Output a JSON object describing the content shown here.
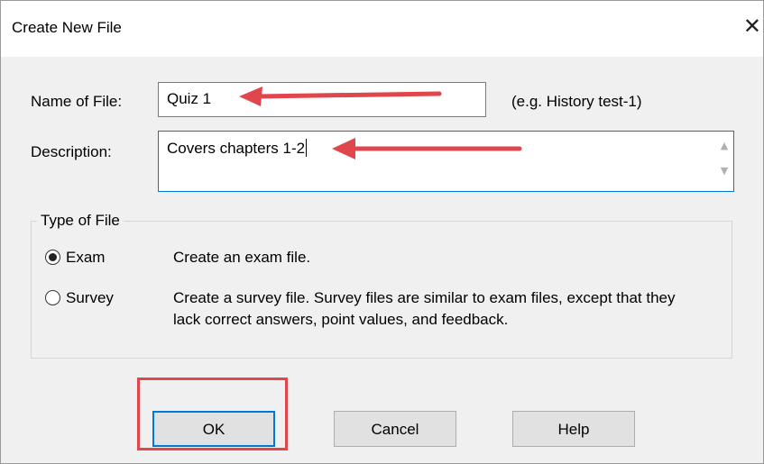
{
  "window": {
    "title": "Create New File",
    "close_glyph": "✕"
  },
  "form": {
    "name_label": "Name of File:",
    "name_value": "Quiz 1",
    "name_hint": "(e.g. History test-1)",
    "description_label": "Description:",
    "description_value": "Covers chapters 1-2"
  },
  "type_group": {
    "title": "Type of File",
    "options": [
      {
        "label": "Exam",
        "selected": true,
        "description": "Create an exam file."
      },
      {
        "label": "Survey",
        "selected": false,
        "description_line1": "Create a survey file.  Survey files are similar to exam files, except that they",
        "description_line2": "lack correct answers, point values, and feedback."
      }
    ]
  },
  "buttons": {
    "ok": "OK",
    "cancel": "Cancel",
    "help": "Help"
  },
  "annotations": {
    "arrow_color": "#e0474c",
    "highlight_color": "#e0474c"
  }
}
